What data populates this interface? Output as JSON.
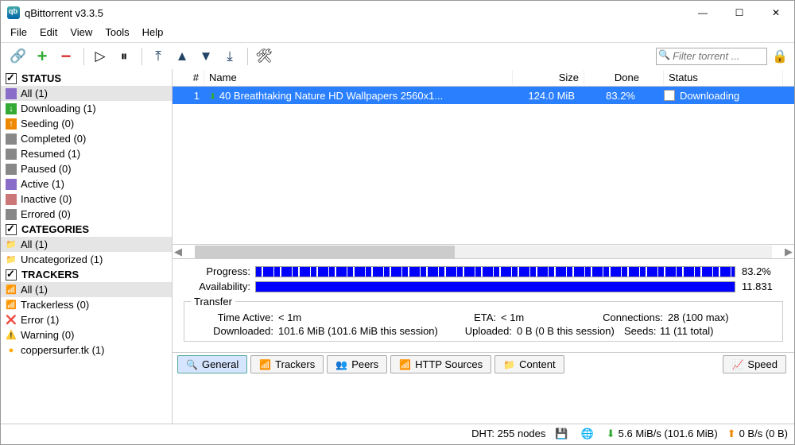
{
  "titlebar": {
    "title": "qBittorrent v3.3.5"
  },
  "menu": {
    "file": "File",
    "edit": "Edit",
    "view": "View",
    "tools": "Tools",
    "help": "Help"
  },
  "toolbar": {
    "filter_placeholder": "Filter torrent ..."
  },
  "sidebar": {
    "status_head": "STATUS",
    "status": [
      {
        "label": "All (1)",
        "color": "#8a6cc9"
      },
      {
        "label": "Downloading (1)",
        "color": "#3a3"
      },
      {
        "label": "Seeding (0)",
        "color": "#e80"
      },
      {
        "label": "Completed (0)",
        "color": "#888"
      },
      {
        "label": "Resumed (1)",
        "color": "#888"
      },
      {
        "label": "Paused (0)",
        "color": "#888"
      },
      {
        "label": "Active (1)",
        "color": "#8a6cc9"
      },
      {
        "label": "Inactive (0)",
        "color": "#c77"
      },
      {
        "label": "Errored (0)",
        "color": "#888"
      }
    ],
    "categories_head": "CATEGORIES",
    "categories": [
      {
        "label": "All (1)"
      },
      {
        "label": "Uncategorized (1)"
      }
    ],
    "trackers_head": "TRACKERS",
    "trackers": [
      {
        "label": "All (1)",
        "ico": "📶"
      },
      {
        "label": "Trackerless (0)",
        "ico": "📶"
      },
      {
        "label": "Error (1)",
        "ico": "❌"
      },
      {
        "label": "Warning (0)",
        "ico": "⚠️"
      },
      {
        "label": "coppersurfer.tk (1)",
        "ico": "🔵"
      }
    ]
  },
  "list": {
    "head": {
      "num": "#",
      "name": "Name",
      "size": "Size",
      "done": "Done",
      "status": "Status"
    },
    "row": {
      "num": "1",
      "name": "40 Breathtaking Nature HD Wallpapers 2560x1...",
      "size": "124.0 MiB",
      "done": "83.2%",
      "status": "Downloading"
    }
  },
  "details": {
    "progress_label": "Progress:",
    "progress_val": "83.2%",
    "availability_label": "Availability:",
    "availability_val": "11.831",
    "transfer_legend": "Transfer",
    "time_active_lbl": "Time Active:",
    "time_active_val": "< 1m",
    "eta_lbl": "ETA:",
    "eta_val": "< 1m",
    "connections_lbl": "Connections:",
    "connections_val": "28 (100 max)",
    "downloaded_lbl": "Downloaded:",
    "downloaded_val": "101.6 MiB (101.6 MiB this session)",
    "uploaded_lbl": "Uploaded:",
    "uploaded_val": "0 B (0 B this session)",
    "seeds_lbl": "Seeds:",
    "seeds_val": "11 (11 total)"
  },
  "tabs": {
    "general": "General",
    "trackers": "Trackers",
    "peers": "Peers",
    "http": "HTTP Sources",
    "content": "Content",
    "speed": "Speed"
  },
  "status": {
    "dht": "DHT: 255 nodes",
    "down": "5.6 MiB/s (101.6 MiB)",
    "up": "0 B/s (0 B)"
  }
}
